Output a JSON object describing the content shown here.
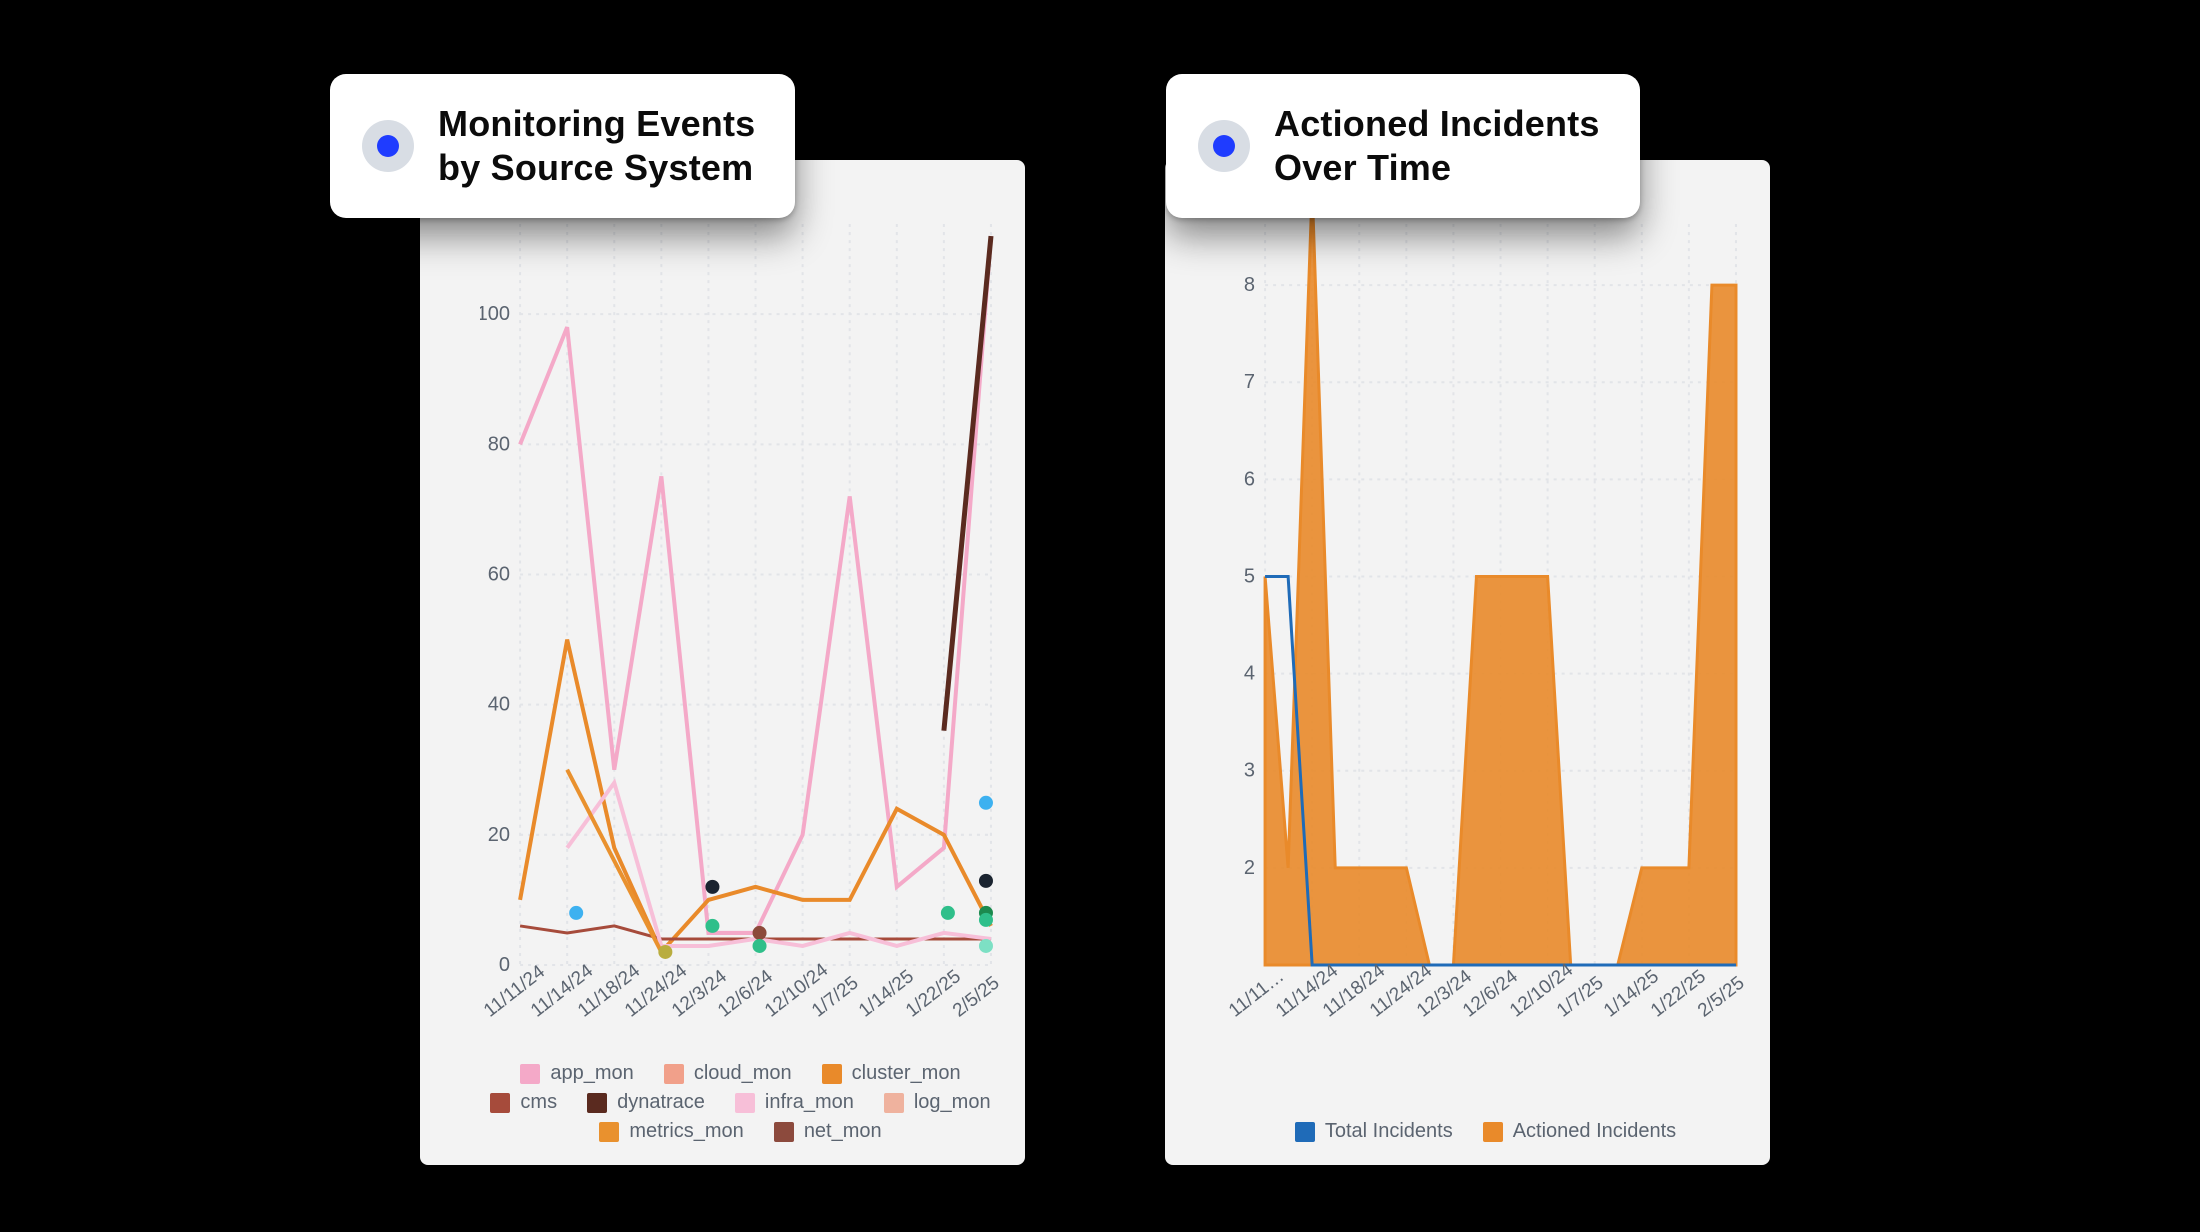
{
  "left": {
    "title_line1": "Monitoring Events",
    "title_line2": "by Source System",
    "yticks": [
      "0",
      "20",
      "40",
      "60",
      "80",
      "100"
    ],
    "xticks": [
      "11/11/24",
      "11/14/24",
      "11/18/24",
      "11/24/24",
      "12/3/24",
      "12/6/24",
      "12/10/24",
      "1/7/25",
      "1/14/25",
      "1/22/25",
      "2/5/25"
    ],
    "legend": [
      {
        "name": "app_mon",
        "color": "#f4a9c8"
      },
      {
        "name": "cloud_mon",
        "color": "#f1a08a"
      },
      {
        "name": "cluster_mon",
        "color": "#e98a2a"
      },
      {
        "name": "cms",
        "color": "#a64b3b"
      },
      {
        "name": "dynatrace",
        "color": "#5a2a1f"
      },
      {
        "name": "infra_mon",
        "color": "#f7bfd8"
      },
      {
        "name": "log_mon",
        "color": "#efb29e"
      },
      {
        "name": "metrics_mon",
        "color": "#e9912e"
      },
      {
        "name": "net_mon",
        "color": "#8c4a3d"
      }
    ]
  },
  "right": {
    "title_line1": "Actioned Incidents",
    "title_line2": "Over Time",
    "yticks": [
      "2",
      "3",
      "4",
      "5",
      "6",
      "7",
      "8"
    ],
    "xticks": [
      "11/11…",
      "11/14/24",
      "11/18/24",
      "11/24/24",
      "12/3/24",
      "12/6/24",
      "12/10/24",
      "1/7/25",
      "1/14/25",
      "1/22/25",
      "2/5/25"
    ],
    "legend": [
      {
        "name": "Total Incidents",
        "color": "#1f6bb8"
      },
      {
        "name": "Actioned Incidents",
        "color": "#e98a2a"
      }
    ]
  },
  "chart_data": [
    {
      "type": "line",
      "title": "Monitoring Events by Source System",
      "ylim": [
        0,
        115
      ],
      "categories": [
        "11/11/24",
        "11/14/24",
        "11/18/24",
        "11/24/24",
        "12/3/24",
        "12/6/24",
        "12/10/24",
        "1/7/25",
        "1/14/25",
        "1/22/25",
        "2/5/25"
      ],
      "series": [
        {
          "name": "app_mon",
          "color": "#f4a9c8",
          "values": [
            80,
            98,
            30,
            75,
            5,
            5,
            20,
            72,
            12,
            18,
            112
          ]
        },
        {
          "name": "cloud_mon",
          "color": "#f1a08a",
          "values": [
            null,
            null,
            null,
            null,
            null,
            null,
            null,
            null,
            null,
            null,
            null
          ]
        },
        {
          "name": "cluster_mon",
          "color": "#e98a2a",
          "values": [
            10,
            50,
            18,
            2,
            10,
            12,
            10,
            10,
            24,
            20,
            6
          ]
        },
        {
          "name": "cms",
          "color": "#a64b3b",
          "values": [
            6,
            5,
            6,
            4,
            4,
            4,
            4,
            4,
            4,
            4,
            4
          ]
        },
        {
          "name": "dynatrace",
          "color": "#5a2a1f",
          "values": [
            null,
            null,
            null,
            null,
            null,
            null,
            null,
            null,
            null,
            36,
            112
          ]
        },
        {
          "name": "infra_mon",
          "color": "#f7bfd8",
          "values": [
            null,
            18,
            28,
            3,
            3,
            4,
            3,
            5,
            3,
            5,
            4
          ]
        },
        {
          "name": "log_mon",
          "color": "#efb29e",
          "values": [
            null,
            null,
            null,
            null,
            null,
            null,
            null,
            null,
            null,
            null,
            null
          ]
        },
        {
          "name": "metrics_mon",
          "color": "#e9912e",
          "values": [
            null,
            30,
            null,
            2,
            null,
            null,
            null,
            null,
            null,
            null,
            null
          ]
        },
        {
          "name": "net_mon",
          "color": "#8c4a3d",
          "values": [
            null,
            null,
            null,
            null,
            6,
            null,
            null,
            null,
            null,
            null,
            null
          ]
        }
      ],
      "scatter_points": [
        {
          "x": "11/14/24",
          "y": 8,
          "color": "#3db1f0"
        },
        {
          "x": "11/24/24",
          "y": 2,
          "color": "#b9ad3f"
        },
        {
          "x": "12/3/24",
          "y": 12,
          "color": "#1b2430"
        },
        {
          "x": "12/3/24",
          "y": 6,
          "color": "#2fbf8a"
        },
        {
          "x": "12/6/24",
          "y": 5,
          "color": "#8c4a3a"
        },
        {
          "x": "12/6/24",
          "y": 3,
          "color": "#2fbf8a"
        },
        {
          "x": "1/22/25",
          "y": 8,
          "color": "#2fbf8a"
        },
        {
          "x": "2/5/25",
          "y": 25,
          "color": "#3db1f0"
        },
        {
          "x": "2/5/25",
          "y": 13,
          "color": "#1b2430"
        },
        {
          "x": "2/5/25",
          "y": 8,
          "color": "#1c8a4e"
        },
        {
          "x": "2/5/25",
          "y": 7,
          "color": "#2fbf8a"
        },
        {
          "x": "2/5/25",
          "y": 3,
          "color": "#7de0c4"
        }
      ]
    },
    {
      "type": "area",
      "title": "Actioned Incidents Over Time",
      "ylim": [
        1,
        9
      ],
      "categories": [
        "11/11/24",
        "11/14/24",
        "11/18/24",
        "11/24/24",
        "12/3/24",
        "12/6/24",
        "12/10/24",
        "1/7/25",
        "1/14/25",
        "1/22/25",
        "2/5/25"
      ],
      "series": [
        {
          "name": "Total Incidents",
          "color": "#1f6bb8",
          "values": [
            5,
            5,
            1,
            1,
            1,
            1,
            1,
            1,
            1,
            1,
            1
          ]
        },
        {
          "name": "Actioned Incidents",
          "color": "#e98a2a",
          "values": [
            5,
            9,
            2,
            2,
            1,
            5,
            5,
            1,
            1,
            2,
            8
          ]
        }
      ]
    }
  ]
}
